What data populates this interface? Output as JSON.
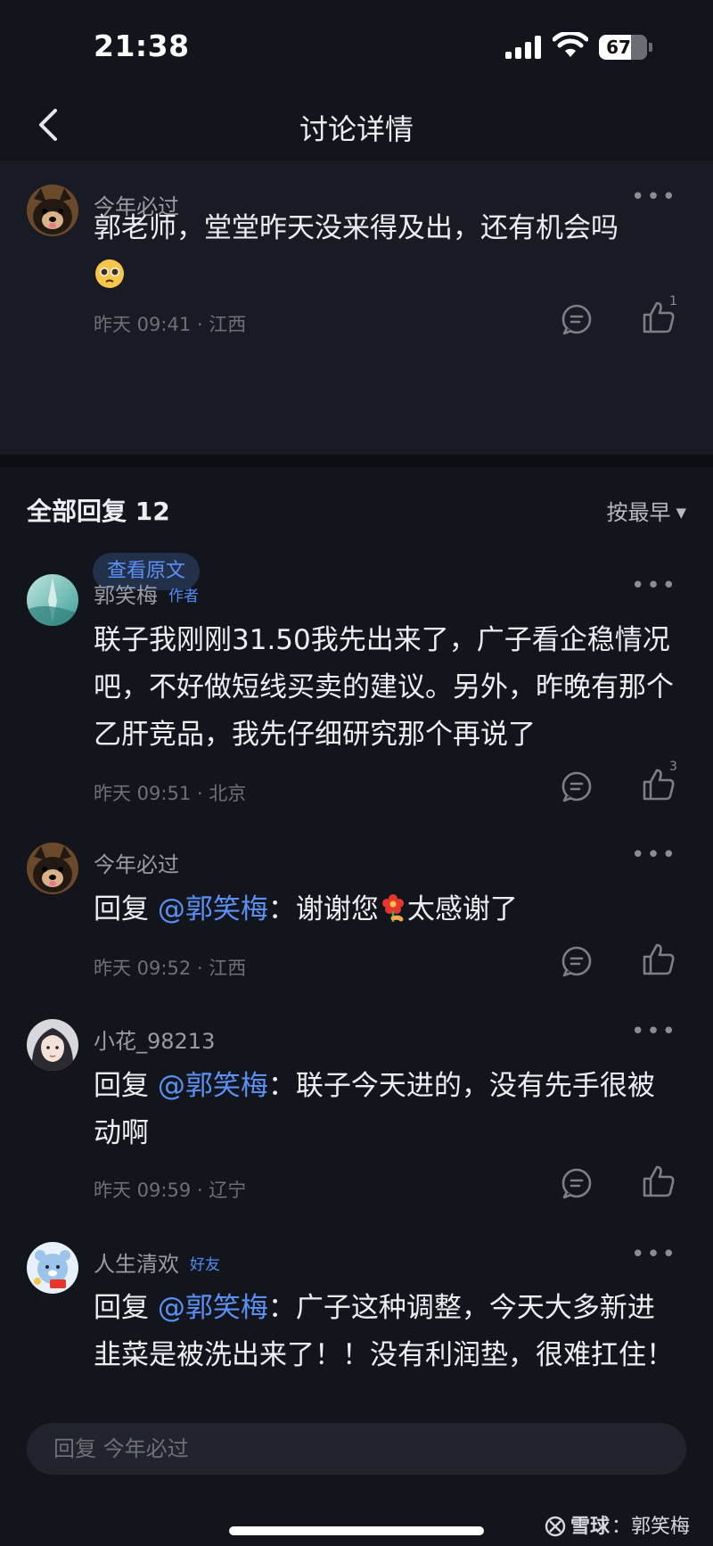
{
  "status": {
    "time": "21:38",
    "battery": "67",
    "battery_level": 0.67
  },
  "nav": {
    "title": "讨论详情"
  },
  "origin": {
    "user": "今年必过",
    "text": "郭老师，堂堂昨天没来得及出，还有机会吗",
    "meta": "昨天 09:41 · 江西",
    "likes": "1",
    "view_original": "查看原文"
  },
  "replies_header": {
    "label": "全部回复 12",
    "sort": "按最早"
  },
  "replies": [
    {
      "user": "郭笑梅",
      "badge": "作者",
      "text": "联子我刚刚31.50我先出来了，广子看企稳情况吧，不好做短线买卖的建议。另外，昨晚有那个乙肝竞品，我先仔细研究那个再说了",
      "meta": "昨天 09:51 · 北京",
      "likes": "3"
    },
    {
      "user": "今年必过",
      "prefix": "回复",
      "mention": "@郭笑梅",
      "text1": "：谢谢您",
      "text2": "太感谢了",
      "meta": "昨天 09:52 · 江西"
    },
    {
      "user": "小花_98213",
      "prefix": "回复",
      "mention": "@郭笑梅",
      "text": "：联子今天进的，没有先手很被动啊",
      "meta": "昨天 09:59 · 辽宁"
    },
    {
      "user": "人生清欢",
      "badge": "好友",
      "prefix": "回复",
      "mention": "@郭笑梅",
      "text": "：广子这种调整，今天大多新进韭菜是被洗出来了！！没有利润垫，很难扛住！"
    }
  ],
  "reply_bar": {
    "placeholder": "回复 今年必过"
  },
  "watermark": {
    "brand": "雪球",
    "sep": "：",
    "author": "郭笑梅"
  }
}
